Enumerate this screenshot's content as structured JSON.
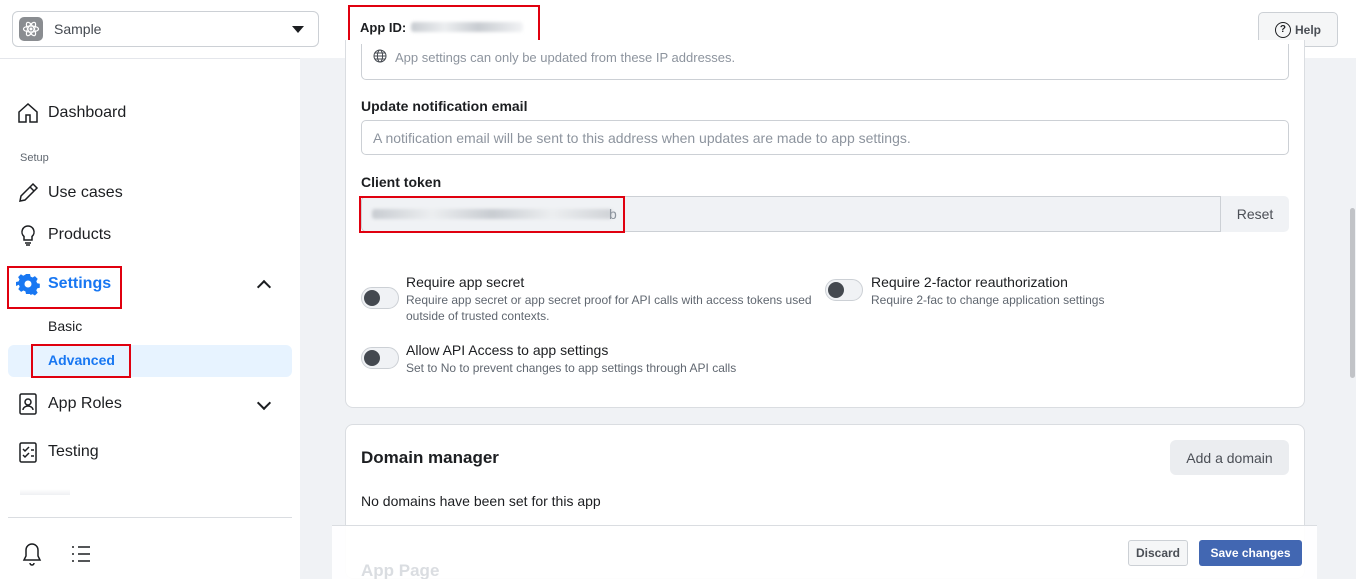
{
  "header": {
    "app_name": "Sample",
    "app_id_label": "App ID:",
    "help_label": "Help"
  },
  "sidebar": {
    "dashboard": "Dashboard",
    "setup_label": "Setup",
    "use_cases": "Use cases",
    "products": "Products",
    "settings": "Settings",
    "settings_sub": {
      "basic": "Basic",
      "advanced": "Advanced"
    },
    "app_roles": "App Roles",
    "testing": "Testing"
  },
  "main": {
    "ip_hint": "App settings can only be updated from these IP addresses.",
    "notification_email": {
      "label": "Update notification email",
      "placeholder": "A notification email will be sent to this address when updates are made to app settings."
    },
    "client_token": {
      "label": "Client token",
      "visible_tail": "b",
      "reset_label": "Reset"
    },
    "toggles": [
      {
        "title": "Require app secret",
        "desc": "Require app secret or app secret proof for API calls with access tokens used outside of trusted contexts.",
        "on": false
      },
      {
        "title": "Require 2-factor reauthorization",
        "desc": "Require 2-fac to change application settings",
        "on": false
      },
      {
        "title": "Allow API Access to app settings",
        "desc": "Set to No to prevent changes to app settings through API calls",
        "on": false
      }
    ],
    "domain_manager": {
      "title": "Domain manager",
      "add_label": "Add a domain",
      "empty_text": "No domains have been set for this app"
    },
    "app_page_title": "App Page"
  },
  "footer": {
    "discard_label": "Discard",
    "save_label": "Save changes"
  },
  "colors": {
    "accent": "#1877f2",
    "save_button": "#4267b2",
    "annotation_box": "#e0000f"
  }
}
